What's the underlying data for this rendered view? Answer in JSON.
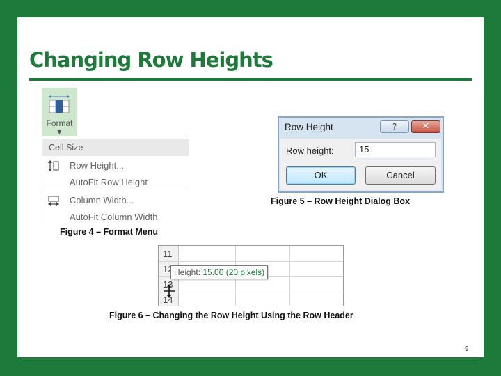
{
  "slide": {
    "title": "Changing Row Heights",
    "page_number": "9",
    "accent_color": "#1e7a3a"
  },
  "figure4": {
    "format_button_label": "Format",
    "format_button_icon": "cell-grid-icon",
    "menu_header": "Cell Size",
    "items": [
      {
        "label": "Row Height...",
        "icon": "row-height-icon"
      },
      {
        "label": "AutoFit Row Height",
        "icon": ""
      },
      {
        "label": "Column Width...",
        "icon": "column-width-icon"
      },
      {
        "label": "AutoFit Column Width",
        "icon": ""
      }
    ],
    "caption": "Figure 4 – Format Menu"
  },
  "figure5": {
    "dialog_title": "Row Height",
    "help_glyph": "?",
    "close_glyph": "✕",
    "field_label": "Row height:",
    "field_value": "15",
    "ok_label": "OK",
    "cancel_label": "Cancel",
    "caption": "Figure 5 – Row Height Dialog Box"
  },
  "figure6": {
    "row_numbers": [
      "11",
      "12",
      "13",
      "14"
    ],
    "tooltip_prefix": "Height: ",
    "tooltip_value": "15.00 (20 pixels)",
    "caption": "Figure 6 – Changing the Row Height Using the Row Header"
  }
}
